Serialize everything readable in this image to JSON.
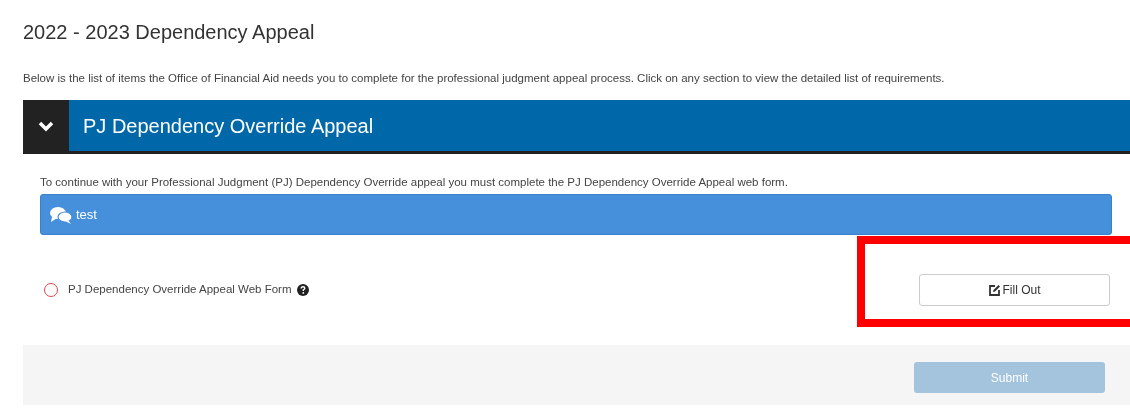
{
  "page": {
    "title": "2022 - 2023 Dependency Appeal",
    "description": "Below is the list of items the Office of Financial Aid needs you to complete for the professional judgment appeal process. Click on any section to view the detailed list of requirements."
  },
  "section": {
    "title": "PJ Dependency Override Appeal",
    "expanded": true,
    "instructions": "To continue with your Professional Judgment (PJ) Dependency Override appeal you must complete the PJ Dependency Override Appeal web form.",
    "message": "test",
    "items": [
      {
        "label": "PJ Dependency Override Appeal Web Form",
        "completed": false,
        "action": "Fill Out",
        "highlighted": true
      }
    ]
  },
  "submit": {
    "label": "Submit",
    "disabled": true
  }
}
